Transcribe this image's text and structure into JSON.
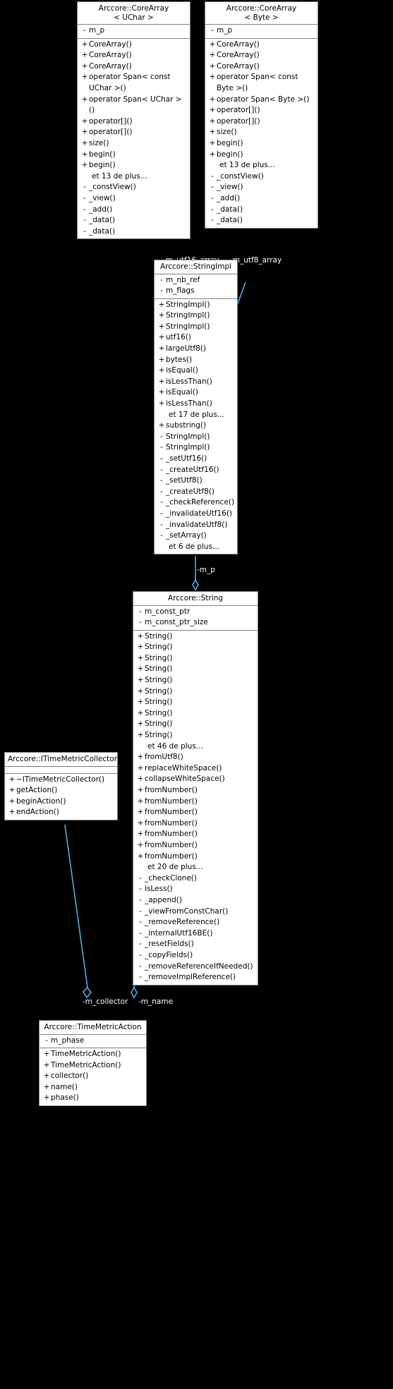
{
  "diagram": {
    "type": "uml-collaboration-diagram",
    "edge_color": "#4FAEE8",
    "box_fill": "#ffffff",
    "box_border": "#808080",
    "background": "#000000",
    "more_suffix_note": "et N de plus..."
  },
  "classes": {
    "core_array_uchar": {
      "name": "Arccore::CoreArray",
      "template": "< UChar >",
      "attributes": [
        {
          "vis": "-",
          "label": "m_p"
        }
      ],
      "operations": [
        {
          "vis": "+",
          "label": "CoreArray()"
        },
        {
          "vis": "+",
          "label": "CoreArray()"
        },
        {
          "vis": "+",
          "label": "CoreArray()"
        },
        {
          "vis": "+",
          "label": "operator Span< const UChar >()"
        },
        {
          "vis": "+",
          "label": "operator Span< UChar >()"
        },
        {
          "vis": "+",
          "label": "operator[]()"
        },
        {
          "vis": "+",
          "label": "operator[]()"
        },
        {
          "vis": "+",
          "label": "size()"
        },
        {
          "vis": "+",
          "label": "begin()"
        },
        {
          "vis": "+",
          "label": "begin()"
        },
        {
          "vis": "",
          "label": "et 13 de plus..."
        },
        {
          "vis": "-",
          "label": "_constView()"
        },
        {
          "vis": "-",
          "label": "_view()"
        },
        {
          "vis": "-",
          "label": "_add()"
        },
        {
          "vis": "-",
          "label": "_data()"
        },
        {
          "vis": "-",
          "label": "_data()"
        }
      ]
    },
    "core_array_byte": {
      "name": "Arccore::CoreArray",
      "template": "< Byte >",
      "attributes": [
        {
          "vis": "-",
          "label": "m_p"
        }
      ],
      "operations": [
        {
          "vis": "+",
          "label": "CoreArray()"
        },
        {
          "vis": "+",
          "label": "CoreArray()"
        },
        {
          "vis": "+",
          "label": "CoreArray()"
        },
        {
          "vis": "+",
          "label": "operator Span< const Byte >()"
        },
        {
          "vis": "+",
          "label": "operator Span< Byte >()"
        },
        {
          "vis": "+",
          "label": "operator[]()"
        },
        {
          "vis": "+",
          "label": "operator[]()"
        },
        {
          "vis": "+",
          "label": "size()"
        },
        {
          "vis": "+",
          "label": "begin()"
        },
        {
          "vis": "+",
          "label": "begin()"
        },
        {
          "vis": "",
          "label": "et 13 de plus..."
        },
        {
          "vis": "-",
          "label": "_constView()"
        },
        {
          "vis": "-",
          "label": "_view()"
        },
        {
          "vis": "-",
          "label": "_add()"
        },
        {
          "vis": "-",
          "label": "_data()"
        },
        {
          "vis": "-",
          "label": "_data()"
        }
      ]
    },
    "string_impl": {
      "name": "Arccore::StringImpl",
      "template": "",
      "attributes": [
        {
          "vis": "-",
          "label": "m_nb_ref"
        },
        {
          "vis": "-",
          "label": "m_flags"
        }
      ],
      "operations": [
        {
          "vis": "+",
          "label": "StringImpl()"
        },
        {
          "vis": "+",
          "label": "StringImpl()"
        },
        {
          "vis": "+",
          "label": "StringImpl()"
        },
        {
          "vis": "+",
          "label": "utf16()"
        },
        {
          "vis": "+",
          "label": "largeUtf8()"
        },
        {
          "vis": "+",
          "label": "bytes()"
        },
        {
          "vis": "+",
          "label": "isEqual()"
        },
        {
          "vis": "+",
          "label": "isLessThan()"
        },
        {
          "vis": "+",
          "label": "isEqual()"
        },
        {
          "vis": "+",
          "label": "isLessThan()"
        },
        {
          "vis": "",
          "label": "et 17 de plus..."
        },
        {
          "vis": "+",
          "label": "substring()"
        },
        {
          "vis": "-",
          "label": "StringImpl()"
        },
        {
          "vis": "-",
          "label": "StringImpl()"
        },
        {
          "vis": "-",
          "label": "_setUtf16()"
        },
        {
          "vis": "-",
          "label": "_createUtf16()"
        },
        {
          "vis": "-",
          "label": "_setUtf8()"
        },
        {
          "vis": "-",
          "label": "_createUtf8()"
        },
        {
          "vis": "-",
          "label": "_checkReference()"
        },
        {
          "vis": "-",
          "label": "_invalidateUtf16()"
        },
        {
          "vis": "-",
          "label": "_invalidateUtf8()"
        },
        {
          "vis": "-",
          "label": "_setArray()"
        },
        {
          "vis": "",
          "label": "et 6 de plus..."
        }
      ]
    },
    "string": {
      "name": "Arccore::String",
      "template": "",
      "attributes": [
        {
          "vis": "-",
          "label": "m_const_ptr"
        },
        {
          "vis": "-",
          "label": "m_const_ptr_size"
        }
      ],
      "operations": [
        {
          "vis": "+",
          "label": "String()"
        },
        {
          "vis": "+",
          "label": "String()"
        },
        {
          "vis": "+",
          "label": "String()"
        },
        {
          "vis": "+",
          "label": "String()"
        },
        {
          "vis": "+",
          "label": "String()"
        },
        {
          "vis": "+",
          "label": "String()"
        },
        {
          "vis": "+",
          "label": "String()"
        },
        {
          "vis": "+",
          "label": "String()"
        },
        {
          "vis": "+",
          "label": "String()"
        },
        {
          "vis": "+",
          "label": "String()"
        },
        {
          "vis": "",
          "label": "et 46 de plus..."
        },
        {
          "vis": "+",
          "label": "fromUtf8()"
        },
        {
          "vis": "+",
          "label": "replaceWhiteSpace()"
        },
        {
          "vis": "+",
          "label": "collapseWhiteSpace()"
        },
        {
          "vis": "+",
          "label": "fromNumber()"
        },
        {
          "vis": "+",
          "label": "fromNumber()"
        },
        {
          "vis": "+",
          "label": "fromNumber()"
        },
        {
          "vis": "+",
          "label": "fromNumber()"
        },
        {
          "vis": "+",
          "label": "fromNumber()"
        },
        {
          "vis": "+",
          "label": "fromNumber()"
        },
        {
          "vis": "+",
          "label": "fromNumber()"
        },
        {
          "vis": "",
          "label": "et 20 de plus..."
        },
        {
          "vis": "-",
          "label": "_checkClone()"
        },
        {
          "vis": "-",
          "label": "isLess()"
        },
        {
          "vis": "-",
          "label": "_append()"
        },
        {
          "vis": "-",
          "label": "_viewFromConstChar()"
        },
        {
          "vis": "-",
          "label": "_removeReference()"
        },
        {
          "vis": "-",
          "label": "_internalUtf16BE()"
        },
        {
          "vis": "-",
          "label": "_resetFields()"
        },
        {
          "vis": "-",
          "label": "_copyFields()"
        },
        {
          "vis": "-",
          "label": "_removeReferenceIfNeeded()"
        },
        {
          "vis": "-",
          "label": "_removeImplReference()"
        }
      ]
    },
    "time_metric_collector": {
      "name": "Arccore::ITimeMetricCollector",
      "template": "",
      "attributes": [],
      "operations": [
        {
          "vis": "+",
          "label": "~ITimeMetricCollector()"
        },
        {
          "vis": "+",
          "label": "getAction()"
        },
        {
          "vis": "+",
          "label": "beginAction()"
        },
        {
          "vis": "+",
          "label": "endAction()"
        }
      ]
    },
    "time_metric_action": {
      "name": "Arccore::TimeMetricAction",
      "template": "",
      "attributes": [
        {
          "vis": "-",
          "label": "m_phase"
        }
      ],
      "operations": [
        {
          "vis": "+",
          "label": "TimeMetricAction()"
        },
        {
          "vis": "+",
          "label": "TimeMetricAction()"
        },
        {
          "vis": "+",
          "label": "collector()"
        },
        {
          "vis": "+",
          "label": "name()"
        },
        {
          "vis": "+",
          "label": "phase()"
        }
      ]
    }
  },
  "edges": [
    {
      "id": "utf16",
      "label": "-m_utf16_array"
    },
    {
      "id": "utf8",
      "label": "-m_utf8_array"
    },
    {
      "id": "mp",
      "label": "-m_p"
    },
    {
      "id": "coll",
      "label": "-m_collector"
    },
    {
      "id": "name",
      "label": "-m_name"
    }
  ]
}
